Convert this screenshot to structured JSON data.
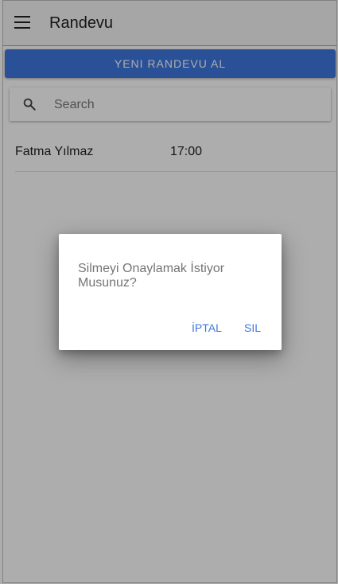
{
  "app": {
    "title": "Randevu",
    "accent": "#3f78e0"
  },
  "actions": {
    "new_appointment_label": "YENI RANDEVU AL"
  },
  "search": {
    "placeholder": "Search",
    "value": ""
  },
  "appointments": [
    {
      "name": "Fatma Yılmaz",
      "time": "17:00"
    }
  ],
  "dialog": {
    "message": "Silmeyi Onaylamak İstiyor Musunuz?",
    "cancel_label": "İPTAL",
    "delete_label": "SIL"
  },
  "icons": {
    "menu": "menu-icon",
    "search": "search-icon"
  }
}
